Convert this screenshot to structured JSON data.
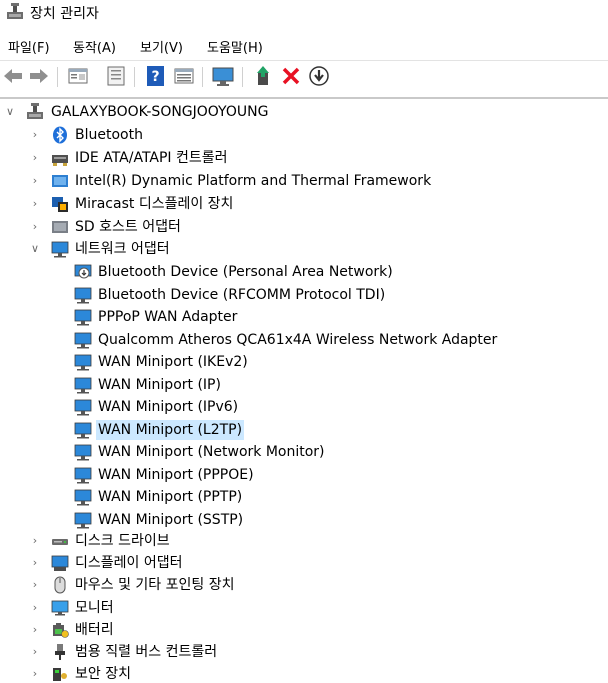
{
  "window": {
    "title": "장치 관리자"
  },
  "menu": [
    "파일(F)",
    "동작(A)",
    "보기(V)",
    "도움말(H)"
  ],
  "toolbar": {
    "buttons": [
      "back-icon",
      "forward-icon",
      "properties-icon",
      "computer-view-icon",
      "help-icon",
      "grid-view-icon",
      "monitor-scan-icon",
      "update-driver-icon",
      "uninstall-icon",
      "download-icon"
    ],
    "colors": {
      "uninstall": "#e81123",
      "help": "#1e5bb8"
    }
  },
  "tree": {
    "root": "GALAXYBOOK-SONGJOOYOUNG",
    "categories_top": [
      "Bluetooth",
      "IDE ATA/ATAPI 컨트롤러",
      "Intel(R) Dynamic Platform and Thermal Framework",
      "Miracast 디스플레이 장치",
      "SD 호스트 어댑터"
    ],
    "expanded_category": "네트워크 어댑터",
    "network_adapters": [
      "Bluetooth Device (Personal Area Network)",
      "Bluetooth Device (RFCOMM Protocol TDI)",
      "PPPoP WAN Adapter",
      "Qualcomm Atheros QCA61x4A Wireless Network Adapter",
      "WAN Miniport (IKEv2)",
      "WAN Miniport (IP)",
      "WAN Miniport (IPv6)",
      "WAN Miniport (L2TP)",
      "WAN Miniport (Network Monitor)",
      "WAN Miniport (PPPOE)",
      "WAN Miniport (PPTP)",
      "WAN Miniport (SSTP)"
    ],
    "selected": "WAN Miniport (L2TP)",
    "categories_bottom": [
      "디스크 드라이브",
      "디스플레이 어댑터",
      "마우스 및 기타 포인팅 장치",
      "모니터",
      "배터리",
      "범용 직렬 버스 컨트롤러",
      "보안 장치"
    ],
    "selection_color": "#cce8ff"
  }
}
